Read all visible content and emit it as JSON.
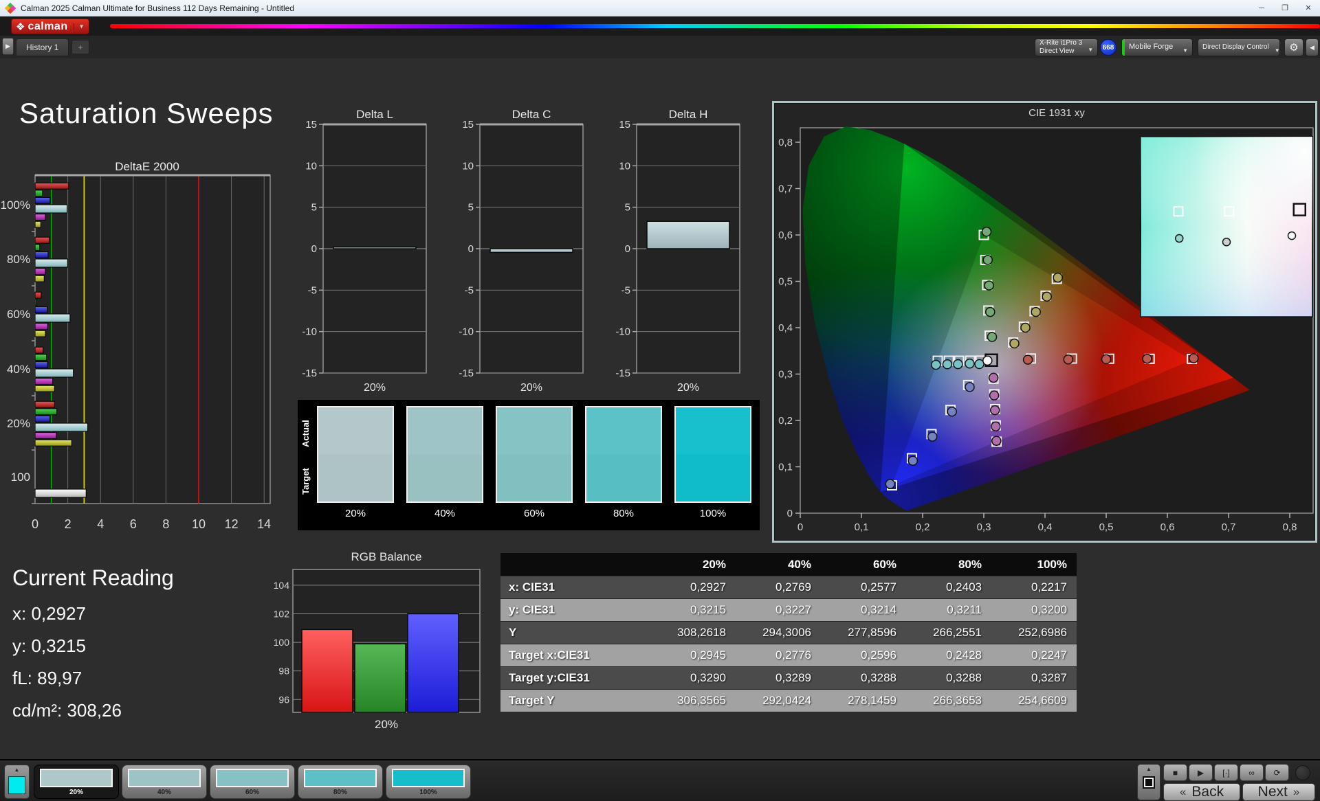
{
  "window": {
    "title": "Calman 2025 Calman Ultimate for Business 112 Days Remaining  - Untitled",
    "controls": {
      "minimize": "─",
      "maximize": "❐",
      "close": "✕"
    }
  },
  "logo": {
    "brand": "calman",
    "diamond": "❖",
    "dropdown": "▼"
  },
  "toolbar": {
    "run_arrow": "▶",
    "history_tab": "History 1",
    "add_tab": "+",
    "meter": {
      "line1": "X-Rite i1Pro 3",
      "line2": "Direct View",
      "badge": "668",
      "stripe": "#22c818"
    },
    "source": {
      "label": "Mobile Forge",
      "stripe": "#22c818"
    },
    "display_control": {
      "label": "Direct Display Control",
      "stripe": "#e8d400"
    },
    "gear": "⚙",
    "collapse": "◀",
    "dropdown": "▼"
  },
  "page": {
    "title": "Saturation Sweeps"
  },
  "current_reading": {
    "title": "Current Reading",
    "lines": [
      "x: 0,2927",
      "y: 0,3215",
      "fL: 89,97",
      "cd/m²: 308,26"
    ]
  },
  "swatch_strip": {
    "row_labels": [
      "Actual",
      "Target"
    ],
    "labels": [
      "20%",
      "40%",
      "60%",
      "80%",
      "100%"
    ],
    "actual_colors": [
      "#b4c7ca",
      "#9ec4c7",
      "#86c3c5",
      "#5dc1c8",
      "#16c0cd"
    ],
    "target_colors": [
      "#aec3c5",
      "#99c1c2",
      "#80c0c1",
      "#57bec4",
      "#10bcc9"
    ]
  },
  "table": {
    "headers": [
      "20%",
      "40%",
      "60%",
      "80%",
      "100%"
    ],
    "rows": [
      {
        "label": "x: CIE31",
        "values": [
          "0,2927",
          "0,2769",
          "0,2577",
          "0,2403",
          "0,2217"
        ]
      },
      {
        "label": "y: CIE31",
        "values": [
          "0,3215",
          "0,3227",
          "0,3214",
          "0,3211",
          "0,3200"
        ]
      },
      {
        "label": "Y",
        "values": [
          "308,2618",
          "294,3006",
          "277,8596",
          "266,2551",
          "252,6986"
        ]
      },
      {
        "label": "Target x:CIE31",
        "values": [
          "0,2945",
          "0,2776",
          "0,2596",
          "0,2428",
          "0,2247"
        ]
      },
      {
        "label": "Target y:CIE31",
        "values": [
          "0,3290",
          "0,3289",
          "0,3288",
          "0,3288",
          "0,3287"
        ]
      },
      {
        "label": "Target Y",
        "values": [
          "306,3565",
          "292,0424",
          "278,1459",
          "266,3653",
          "254,6609"
        ]
      }
    ],
    "row_bg": [
      "#4b4b4b",
      "#a2a2a2"
    ]
  },
  "bottom_bar": {
    "current_patch_color": "#00ecec",
    "patches": [
      {
        "label": "20%",
        "color": "#aec7c9",
        "selected": true
      },
      {
        "label": "40%",
        "color": "#9dc3c6",
        "selected": false
      },
      {
        "label": "60%",
        "color": "#86c2c5",
        "selected": false
      },
      {
        "label": "80%",
        "color": "#5dc0c7",
        "selected": false
      },
      {
        "label": "100%",
        "color": "#16bdca",
        "selected": false
      }
    ],
    "transport_icons": [
      "■",
      "▶",
      "[·]",
      "∞",
      "⟳"
    ],
    "back": "Back",
    "next": "Next",
    "chev_left": "«",
    "chev_right": "»"
  },
  "chart_data": [
    {
      "id": "deltae2000",
      "type": "bar",
      "orientation": "horizontal",
      "title": "DeltaE 2000",
      "xlim": [
        0,
        15
      ],
      "xticks": [
        0,
        2,
        4,
        6,
        8,
        10,
        12,
        14
      ],
      "series": [
        "red",
        "green",
        "blue",
        "cyan",
        "magenta",
        "yellow"
      ],
      "groups": [
        {
          "label": "100%",
          "bars": [
            {
              "c": "red",
              "v": 2.05
            },
            {
              "c": "green",
              "v": 0.46
            },
            {
              "c": "blue",
              "v": 0.92
            },
            {
              "c": "cyan",
              "v": 1.96
            },
            {
              "c": "magenta",
              "v": 0.63
            },
            {
              "c": "yellow",
              "v": 0.35
            }
          ]
        },
        {
          "label": "80%",
          "bars": [
            {
              "c": "red",
              "v": 0.88
            },
            {
              "c": "green",
              "v": 0.28
            },
            {
              "c": "blue",
              "v": 0.8
            },
            {
              "c": "cyan",
              "v": 1.99
            },
            {
              "c": "magenta",
              "v": 0.63
            },
            {
              "c": "yellow",
              "v": 0.56
            }
          ]
        },
        {
          "label": "60%",
          "bars": [
            {
              "c": "red",
              "v": 0.38
            },
            {
              "c": "green",
              "v": 0.08
            },
            {
              "c": "blue",
              "v": 0.74
            },
            {
              "c": "cyan",
              "v": 2.14
            },
            {
              "c": "magenta",
              "v": 0.77
            },
            {
              "c": "yellow",
              "v": 0.63
            }
          ]
        },
        {
          "label": "40%",
          "bars": [
            {
              "c": "red",
              "v": 0.49
            },
            {
              "c": "green",
              "v": 0.7
            },
            {
              "c": "blue",
              "v": 0.77
            },
            {
              "c": "cyan",
              "v": 2.34
            },
            {
              "c": "magenta",
              "v": 1.08
            },
            {
              "c": "yellow",
              "v": 1.19
            }
          ]
        },
        {
          "label": "20%",
          "bars": [
            {
              "c": "red",
              "v": 1.19
            },
            {
              "c": "green",
              "v": 1.33
            },
            {
              "c": "blue",
              "v": 0.91
            },
            {
              "c": "cyan",
              "v": 3.22
            },
            {
              "c": "magenta",
              "v": 1.3
            },
            {
              "c": "yellow",
              "v": 2.24
            }
          ]
        },
        {
          "label": "100",
          "bars": [
            {
              "c": "white",
              "v": 3.12
            }
          ]
        }
      ],
      "bar_colors": {
        "red": [
          "#e05a5a",
          "#9c1414"
        ],
        "green": [
          "#58d058",
          "#148a14"
        ],
        "blue": [
          "#6066e8",
          "#1414a0"
        ],
        "cyan": [
          "#dceef0",
          "#7fb4b8"
        ],
        "magenta": [
          "#e06ce0",
          "#8e188e"
        ],
        "yellow": [
          "#e8e868",
          "#9a9a18"
        ],
        "white": [
          "#ffffff",
          "#b8b8b8"
        ]
      },
      "reference_lines": [
        {
          "value": 1,
          "color": "#00a400"
        },
        {
          "value": 3,
          "color": "#d8d800"
        },
        {
          "value": 10,
          "color": "#d01010"
        }
      ]
    },
    {
      "id": "delta_l",
      "type": "bar",
      "title": "Delta L",
      "categories": [
        "20%"
      ],
      "values": [
        0.2
      ],
      "ylim": [
        -15,
        15
      ],
      "yticks": [
        15,
        10,
        5,
        0,
        -5,
        -10,
        -15
      ]
    },
    {
      "id": "delta_c",
      "type": "bar",
      "title": "Delta C",
      "categories": [
        "20%"
      ],
      "values": [
        -0.45
      ],
      "ylim": [
        -15,
        15
      ],
      "yticks": [
        15,
        10,
        5,
        0,
        -5,
        -10,
        -15
      ]
    },
    {
      "id": "delta_h",
      "type": "bar",
      "title": "Delta H",
      "categories": [
        "20%"
      ],
      "values": [
        3.3
      ],
      "ylim": [
        -15,
        15
      ],
      "yticks": [
        15,
        10,
        5,
        0,
        -5,
        -10,
        -15
      ]
    },
    {
      "id": "rgb_balance",
      "type": "bar",
      "title": "RGB Balance",
      "xlabel": "20%",
      "categories": [
        "Red",
        "Green",
        "Blue"
      ],
      "values": [
        100.9,
        99.9,
        102.0
      ],
      "colors": [
        [
          "#ff6060",
          "#d81414"
        ],
        [
          "#55b855",
          "#258525"
        ],
        [
          "#6060ff",
          "#1c1cd8"
        ]
      ],
      "ylim": [
        95.1,
        105.1
      ],
      "yticks": [
        104,
        102,
        100,
        98,
        96
      ]
    },
    {
      "id": "cie",
      "type": "scatter",
      "title": "CIE 1931 xy",
      "xlim": [
        0,
        0.836
      ],
      "ylim": [
        0,
        0.831
      ],
      "xticks": [
        0,
        0.1,
        0.2,
        0.3,
        0.4,
        0.5,
        0.6,
        0.7,
        0.8
      ],
      "yticks": [
        0,
        0.1,
        0.2,
        0.3,
        0.4,
        0.5,
        0.6,
        0.7,
        0.8
      ],
      "tick_labels": [
        "0",
        "0,1",
        "0,2",
        "0,3",
        "0,4",
        "0,5",
        "0,6",
        "0,7",
        "0,8"
      ],
      "gamut_triangle": [
        [
          0.64,
          0.33
        ],
        [
          0.3,
          0.6
        ],
        [
          0.15,
          0.06
        ]
      ],
      "outer_triangle": [
        [
          0.708,
          0.292
        ],
        [
          0.17,
          0.797
        ],
        [
          0.131,
          0.046
        ]
      ],
      "white_point": {
        "target": [
          0.3124,
          0.33
        ],
        "measured": [
          0.306,
          0.329
        ]
      },
      "sweeps": [
        {
          "name": "red",
          "dot": "#bb5a52",
          "targets": [
            [
              0.377,
              0.3335
            ],
            [
              0.444,
              0.3333
            ],
            [
              0.505,
              0.3331
            ],
            [
              0.571,
              0.3329
            ],
            [
              0.64,
              0.3327
            ]
          ],
          "measured": [
            [
              0.372,
              0.331
            ],
            [
              0.438,
              0.3315
            ],
            [
              0.5,
              0.332
            ],
            [
              0.567,
              0.333
            ],
            [
              0.643,
              0.334
            ]
          ]
        },
        {
          "name": "green",
          "dot": "#74a874",
          "targets": [
            [
              0.3095,
              0.383
            ],
            [
              0.3075,
              0.437
            ],
            [
              0.3055,
              0.492
            ],
            [
              0.3025,
              0.546
            ],
            [
              0.3,
              0.6
            ]
          ],
          "measured": [
            [
              0.3135,
              0.38
            ],
            [
              0.3105,
              0.434
            ],
            [
              0.3085,
              0.491
            ],
            [
              0.3065,
              0.546
            ],
            [
              0.3045,
              0.607
            ]
          ]
        },
        {
          "name": "blue",
          "dot": "#7681c4",
          "targets": [
            [
              0.2745,
              0.2765
            ],
            [
              0.2455,
              0.2225
            ],
            [
              0.2145,
              0.1705
            ],
            [
              0.1825,
              0.1185
            ],
            [
              0.15,
              0.06
            ]
          ],
          "measured": [
            [
              0.277,
              0.272
            ],
            [
              0.248,
              0.219
            ],
            [
              0.216,
              0.165
            ],
            [
              0.184,
              0.113
            ],
            [
              0.147,
              0.063
            ]
          ]
        },
        {
          "name": "cyan",
          "dot": "#79c2c5",
          "targets": [
            [
              0.2945,
              0.329
            ],
            [
              0.2776,
              0.3289
            ],
            [
              0.2596,
              0.3288
            ],
            [
              0.2428,
              0.3288
            ],
            [
              0.2247,
              0.3287
            ]
          ],
          "measured": [
            [
              0.2927,
              0.3215
            ],
            [
              0.2769,
              0.3227
            ],
            [
              0.2577,
              0.3214
            ],
            [
              0.2403,
              0.3211
            ],
            [
              0.2217,
              0.32
            ]
          ]
        },
        {
          "name": "magenta",
          "dot": "#b06fa8",
          "targets": [
            [
              0.316,
              0.29
            ],
            [
              0.3172,
              0.2565
            ],
            [
              0.3184,
              0.2245
            ],
            [
              0.3196,
              0.1895
            ],
            [
              0.3209,
              0.1542
            ]
          ],
          "measured": [
            [
              0.3158,
              0.292
            ],
            [
              0.317,
              0.254
            ],
            [
              0.3182,
              0.222
            ],
            [
              0.3194,
              0.187
            ],
            [
              0.3206,
              0.156
            ]
          ]
        },
        {
          "name": "yellow",
          "dot": "#b0a763",
          "targets": [
            [
              0.348,
              0.368
            ],
            [
              0.3655,
              0.402
            ],
            [
              0.383,
              0.4355
            ],
            [
              0.401,
              0.469
            ],
            [
              0.4193,
              0.5053
            ]
          ],
          "measured": [
            [
              0.35,
              0.366
            ],
            [
              0.368,
              0.4
            ],
            [
              0.385,
              0.434
            ],
            [
              0.403,
              0.467
            ],
            [
              0.421,
              0.508
            ]
          ]
        }
      ],
      "inset": {
        "squares": [
          [
            0.22,
            0.415
          ],
          [
            0.515,
            0.415
          ]
        ],
        "big_square": [
          0.925,
          0.405
        ],
        "circles": [
          {
            "pos": [
              0.225,
              0.565
            ],
            "fill": "#8fd8cc"
          },
          {
            "pos": [
              0.5,
              0.585
            ],
            "fill": "#c9ced0"
          },
          {
            "pos": [
              0.88,
              0.55
            ],
            "fill": "#f2f6f6"
          }
        ]
      }
    }
  ]
}
